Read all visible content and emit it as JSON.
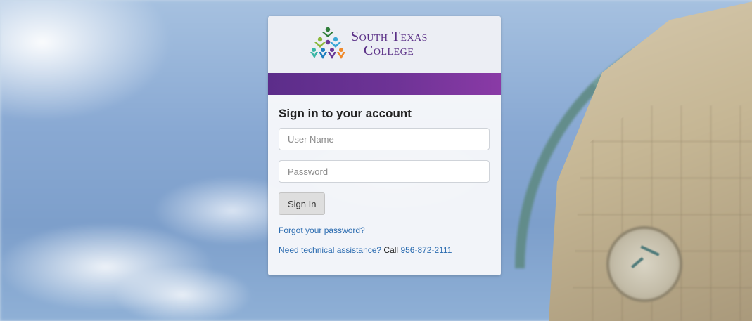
{
  "branding": {
    "logo_line1": "South Texas",
    "logo_line2": "College",
    "brand_color": "#5a2f86",
    "band_gradient": [
      "#5c2d8a",
      "#8a3aa6"
    ]
  },
  "login": {
    "heading": "Sign in to your account",
    "username_placeholder": "User Name",
    "password_placeholder": "Password",
    "username_value": "",
    "password_value": "",
    "sign_in_label": "Sign In",
    "forgot_password_label": "Forgot your password?",
    "assistance_label": "Need technical assistance?",
    "call_text": " Call ",
    "phone_number": "956-872-2111"
  },
  "colors": {
    "link": "#2a6bb0",
    "button_bg": "#dedede"
  }
}
